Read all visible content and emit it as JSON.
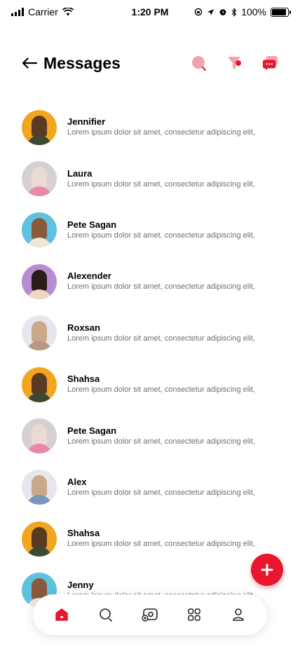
{
  "status_bar": {
    "carrier": "Carrier",
    "time": "1:20 PM",
    "battery_percent": "100%",
    "battery_level": 1.0,
    "icons": [
      "signal-icon",
      "wifi-icon",
      "screen-lock-icon",
      "location-icon",
      "alarm-icon",
      "bluetooth-icon",
      "battery-icon"
    ]
  },
  "header": {
    "title": "Messages",
    "actions": [
      "search-icon",
      "filter-icon",
      "new-chat-icon"
    ]
  },
  "colors": {
    "accent": "#e8162c",
    "accent_light": "#f28a98"
  },
  "messages": [
    {
      "name": "Jennifier",
      "preview": "Lorem ipsum dolor sit amet, consectetur adipiscing elit,"
    },
    {
      "name": "Laura",
      "preview": "Lorem ipsum dolor sit amet, consectetur adipiscing elit,"
    },
    {
      "name": "Pete Sagan",
      "preview": "Lorem ipsum dolor sit amet, consectetur adipiscing elit,"
    },
    {
      "name": "Alexender",
      "preview": "Lorem ipsum dolor sit amet, consectetur adipiscing elit,"
    },
    {
      "name": "Roxsan",
      "preview": "Lorem ipsum dolor sit amet, consectetur adipiscing elit,"
    },
    {
      "name": "Shahsa",
      "preview": "Lorem ipsum dolor sit amet, consectetur adipiscing elit,"
    },
    {
      "name": "Pete Sagan",
      "preview": "Lorem ipsum dolor sit amet, consectetur adipiscing elit,"
    },
    {
      "name": "Alex",
      "preview": "Lorem ipsum dolor sit amet, consectetur adipiscing elit,"
    },
    {
      "name": "Shahsa",
      "preview": "Lorem ipsum dolor sit amet, consectetur adipiscing elit,"
    },
    {
      "name": "Jenny",
      "preview": "Lorem ipsum dolor sit amet, consectetur adipiscing elit,"
    }
  ],
  "fab": {
    "label": "+"
  },
  "bottom_nav": [
    {
      "icon": "home-icon",
      "active": true
    },
    {
      "icon": "search-icon",
      "active": false
    },
    {
      "icon": "camera-add-icon",
      "active": false
    },
    {
      "icon": "apps-grid-icon",
      "active": false
    },
    {
      "icon": "profile-icon",
      "active": false
    }
  ]
}
